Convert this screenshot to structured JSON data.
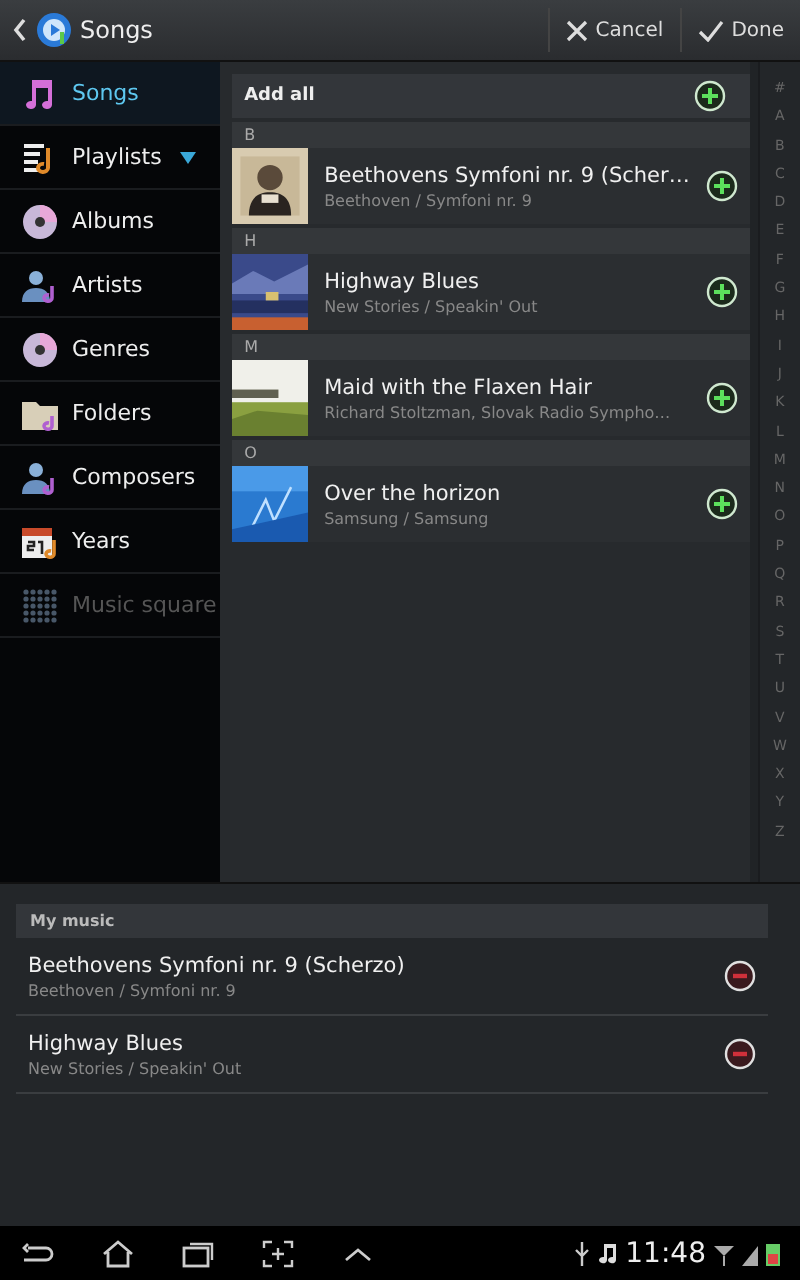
{
  "action_bar": {
    "title": "Songs",
    "cancel": "Cancel",
    "done": "Done"
  },
  "sidebar": {
    "items": [
      {
        "label": "Songs",
        "kind": "item",
        "selected": true,
        "disabled": false
      },
      {
        "label": "Playlists",
        "kind": "dropdown",
        "selected": false,
        "disabled": false
      },
      {
        "label": "Albums",
        "kind": "item",
        "selected": false,
        "disabled": false
      },
      {
        "label": "Artists",
        "kind": "item",
        "selected": false,
        "disabled": false
      },
      {
        "label": "Genres",
        "kind": "item",
        "selected": false,
        "disabled": false
      },
      {
        "label": "Folders",
        "kind": "item",
        "selected": false,
        "disabled": false
      },
      {
        "label": "Composers",
        "kind": "item",
        "selected": false,
        "disabled": false
      },
      {
        "label": "Years",
        "kind": "item",
        "selected": false,
        "disabled": false
      },
      {
        "label": "Music square",
        "kind": "item",
        "selected": false,
        "disabled": true
      }
    ]
  },
  "song_list": {
    "add_all": "Add all",
    "sections": [
      {
        "letter": "B",
        "songs": [
          {
            "title": "Beethovens Symfoni nr. 9 (Scher…",
            "subtitle": "Beethoven / Symfoni nr. 9"
          }
        ]
      },
      {
        "letter": "H",
        "songs": [
          {
            "title": "Highway Blues",
            "subtitle": "New Stories / Speakin' Out"
          }
        ]
      },
      {
        "letter": "M",
        "songs": [
          {
            "title": "Maid with the Flaxen Hair",
            "subtitle": "Richard Stoltzman, Slovak Radio Sympho…"
          }
        ]
      },
      {
        "letter": "O",
        "songs": [
          {
            "title": "Over the horizon",
            "subtitle": "Samsung / Samsung"
          }
        ]
      }
    ]
  },
  "index_bar": [
    "#",
    "A",
    "B",
    "C",
    "D",
    "E",
    "F",
    "G",
    "H",
    "I",
    "J",
    "K",
    "L",
    "M",
    "N",
    "O",
    "P",
    "Q",
    "R",
    "S",
    "T",
    "U",
    "V",
    "W",
    "X",
    "Y",
    "Z"
  ],
  "my_music": {
    "header": "My music",
    "songs": [
      {
        "title": "Beethovens Symfoni nr. 9 (Scherzo)",
        "subtitle": "Beethoven / Symfoni nr. 9"
      },
      {
        "title": "Highway Blues",
        "subtitle": "New Stories / Speakin' Out"
      }
    ]
  },
  "status_bar": {
    "time": "11:48"
  }
}
